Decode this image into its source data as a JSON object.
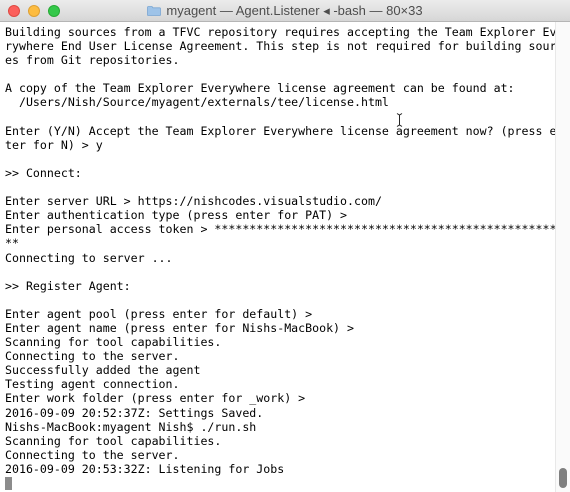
{
  "window": {
    "title": "myagent — Agent.Listener ◂ -bash — 80×33",
    "accent_close": "#fc605c",
    "accent_minimize": "#fdbc40",
    "accent_maximize": "#34c84a"
  },
  "terminal": {
    "lines": [
      "Building sources from a TFVC repository requires accepting the Team Explorer Eve",
      "rywhere End User License Agreement. This step is not required for building sourc",
      "es from Git repositories.",
      "",
      "A copy of the Team Explorer Everywhere license agreement can be found at:",
      "  /Users/Nish/Source/myagent/externals/tee/license.html",
      "",
      "Enter (Y/N) Accept the Team Explorer Everywhere license agreement now? (press en",
      "ter for N) > y",
      "",
      ">> Connect:",
      "",
      "Enter server URL > https://nishcodes.visualstudio.com/",
      "Enter authentication type (press enter for PAT) >",
      "Enter personal access token > ****************************************************",
      "**",
      "Connecting to server ...",
      "",
      ">> Register Agent:",
      "",
      "Enter agent pool (press enter for default) >",
      "Enter agent name (press enter for Nishs-MacBook) >",
      "Scanning for tool capabilities.",
      "Connecting to the server.",
      "Successfully added the agent",
      "Testing agent connection.",
      "Enter work folder (press enter for _work) >",
      "2016-09-09 20:52:37Z: Settings Saved.",
      "Nishs-MacBook:myagent Nish$ ./run.sh",
      "Scanning for tool capabilities.",
      "Connecting to the server.",
      "2016-09-09 20:53:32Z: Listening for Jobs"
    ]
  },
  "scrollbar": {
    "position_fraction": 1.0
  }
}
